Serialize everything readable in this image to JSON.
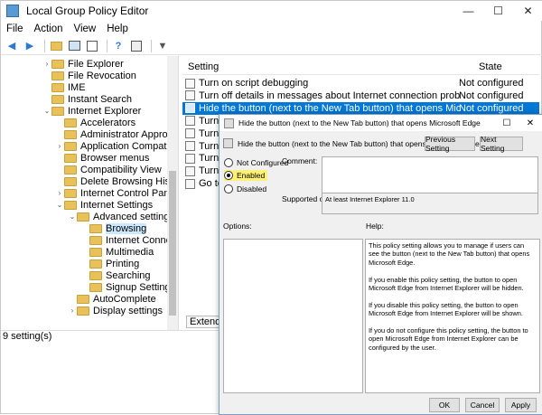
{
  "window": {
    "title": "Local Group Policy Editor",
    "minimize": "—",
    "maximize": "☐",
    "close": "✕"
  },
  "menu": [
    "File",
    "Action",
    "View",
    "Help"
  ],
  "tree": {
    "items": [
      {
        "label": "File Explorer",
        "expander": "›",
        "level": 5
      },
      {
        "label": "File Revocation",
        "expander": "",
        "level": 5
      },
      {
        "label": "IME",
        "expander": "",
        "level": 5
      },
      {
        "label": "Instant Search",
        "expander": "",
        "level": 5
      },
      {
        "label": "Internet Explorer",
        "expander": "⌄",
        "level": 5
      },
      {
        "label": "Accelerators",
        "expander": "",
        "level": 6
      },
      {
        "label": "Administrator Approved C",
        "expander": "",
        "level": 6
      },
      {
        "label": "Application Compatibility",
        "expander": "›",
        "level": 6
      },
      {
        "label": "Browser menus",
        "expander": "",
        "level": 6
      },
      {
        "label": "Compatibility View",
        "expander": "",
        "level": 6
      },
      {
        "label": "Delete Browsing History",
        "expander": "",
        "level": 6
      },
      {
        "label": "Internet Control Panel",
        "expander": "›",
        "level": 6
      },
      {
        "label": "Internet Settings",
        "expander": "⌄",
        "level": 6
      },
      {
        "label": "Advanced settings",
        "expander": "⌄",
        "level": 7
      },
      {
        "label": "Browsing",
        "expander": "",
        "level": 8,
        "selected": true
      },
      {
        "label": "Internet Connectio",
        "expander": "",
        "level": 8
      },
      {
        "label": "Multimedia",
        "expander": "",
        "level": 8
      },
      {
        "label": "Printing",
        "expander": "",
        "level": 8
      },
      {
        "label": "Searching",
        "expander": "",
        "level": 8
      },
      {
        "label": "Signup Settings",
        "expander": "",
        "level": 8
      },
      {
        "label": "AutoComplete",
        "expander": "",
        "level": 7
      },
      {
        "label": "Display settings",
        "expander": "›",
        "level": 7
      }
    ]
  },
  "list": {
    "col_setting": "Setting",
    "col_state": "State",
    "rows": [
      {
        "name": "Turn on script debugging",
        "state": "Not configured"
      },
      {
        "name": "Turn off details in messages about Internet connection problems",
        "state": "Not configured"
      },
      {
        "name": "Hide the button (next to the New Tab button) that opens Microsoft Edge",
        "state": "Not configured",
        "selected": true
      },
      {
        "name": "Turn off page transitions",
        "state": ""
      },
      {
        "name": "Turn o",
        "state": ""
      },
      {
        "name": "Turn o",
        "state": ""
      },
      {
        "name": "Turn o",
        "state": ""
      },
      {
        "name": "Turn o",
        "state": ""
      },
      {
        "name": "Go to",
        "state": ""
      }
    ],
    "tab_extended": "Extended"
  },
  "status": "9 setting(s)",
  "dialog": {
    "title": "Hide the button (next to the New Tab button) that opens Microsoft Edge",
    "heading": "Hide the button (next to the New Tab button) that opens Microsoft Edge",
    "prev_button": "Previous Setting",
    "next_button": "Next Setting",
    "radio_not_configured": "Not Configured",
    "radio_enabled": "Enabled",
    "radio_disabled": "Disabled",
    "comment_label": "Comment:",
    "supported_label": "Supported on:",
    "supported_value": "At least Internet Explorer 11.0",
    "options_label": "Options:",
    "help_label": "Help:",
    "help": [
      "This policy setting allows you to manage if users can see the button (next to the New Tab button) that opens Microsoft Edge.",
      "If you enable this policy setting, the button to open Microsoft Edge from Internet Explorer will be hidden.",
      "If you disable this policy setting, the button to open Microsoft Edge from Internet Explorer will be shown.",
      "If you do not configure this policy setting, the button to open Microsoft Edge from Internet Explorer can be configured by the user."
    ],
    "ok": "OK",
    "cancel": "Cancel",
    "apply": "Apply",
    "close": "✕",
    "maximize": "☐"
  }
}
